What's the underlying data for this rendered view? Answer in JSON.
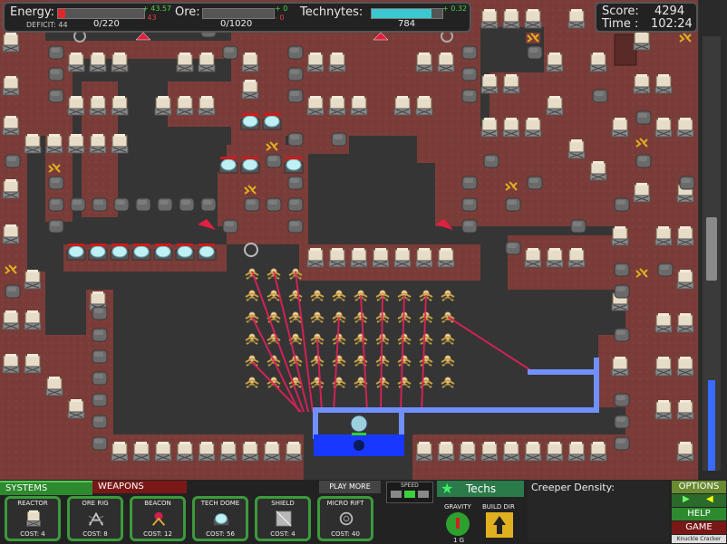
{
  "hud": {
    "energy_label": "Energy:",
    "energy_plus": "+ 43.57",
    "energy_minus": "- 43",
    "deficit_label": "DEFICIT: 44",
    "energy_value": "0/220",
    "energy_fill": 0.08,
    "ore_label": "Ore:",
    "ore_plus": "+ 0",
    "ore_minus": "- 0",
    "ore_value": "0/1020",
    "ore_fill": 0.0,
    "technytes_label": "Technytes:",
    "technytes_plus": "+ 0.32",
    "technytes_value": "784",
    "technytes_fill": 0.85
  },
  "score": {
    "score_label": "Score:",
    "score_value": "4294",
    "time_label": "Time :",
    "time_value": "102:24"
  },
  "panel": {
    "systems_tab": "SYSTEMS",
    "weapons_tab": "WEAPONS",
    "play_more": "PLAY MORE",
    "speed_label": "SPEED",
    "techs_label": "Techs",
    "gravity_label": "GRAVITY",
    "gravity_value": "1 G",
    "build_dir_label": "BUILD DIR",
    "creeper_density": "Creeper Density:",
    "options": "OPTIONS",
    "help": "HELP",
    "game": "GAME",
    "knuckle": "Knuckle Cracker",
    "slots": [
      {
        "title": "REACTOR",
        "cost": "COST: 4",
        "icon": "reactor-icon"
      },
      {
        "title": "ORE RIG",
        "cost": "COST: 8",
        "icon": "ore-rig-icon"
      },
      {
        "title": "BEACON",
        "cost": "COST: 12",
        "icon": "beacon-icon"
      },
      {
        "title": "TECH DOME",
        "cost": "COST: 56",
        "icon": "tech-dome-icon"
      },
      {
        "title": "SHIELD",
        "cost": "COST: 4",
        "icon": "shield-icon"
      },
      {
        "title": "MICRO RIFT",
        "cost": "COST: 40",
        "icon": "micro-rift-icon"
      }
    ]
  },
  "colors": {
    "ground": "#7a3a36",
    "floor": "#333333",
    "energy": "#e02828",
    "ore": "#888888",
    "technytes": "#3cc8d0",
    "laser": "#e02060",
    "pipe": "#6a8aff",
    "base": "#1a3aff",
    "accent_green": "#3c9a3c"
  }
}
